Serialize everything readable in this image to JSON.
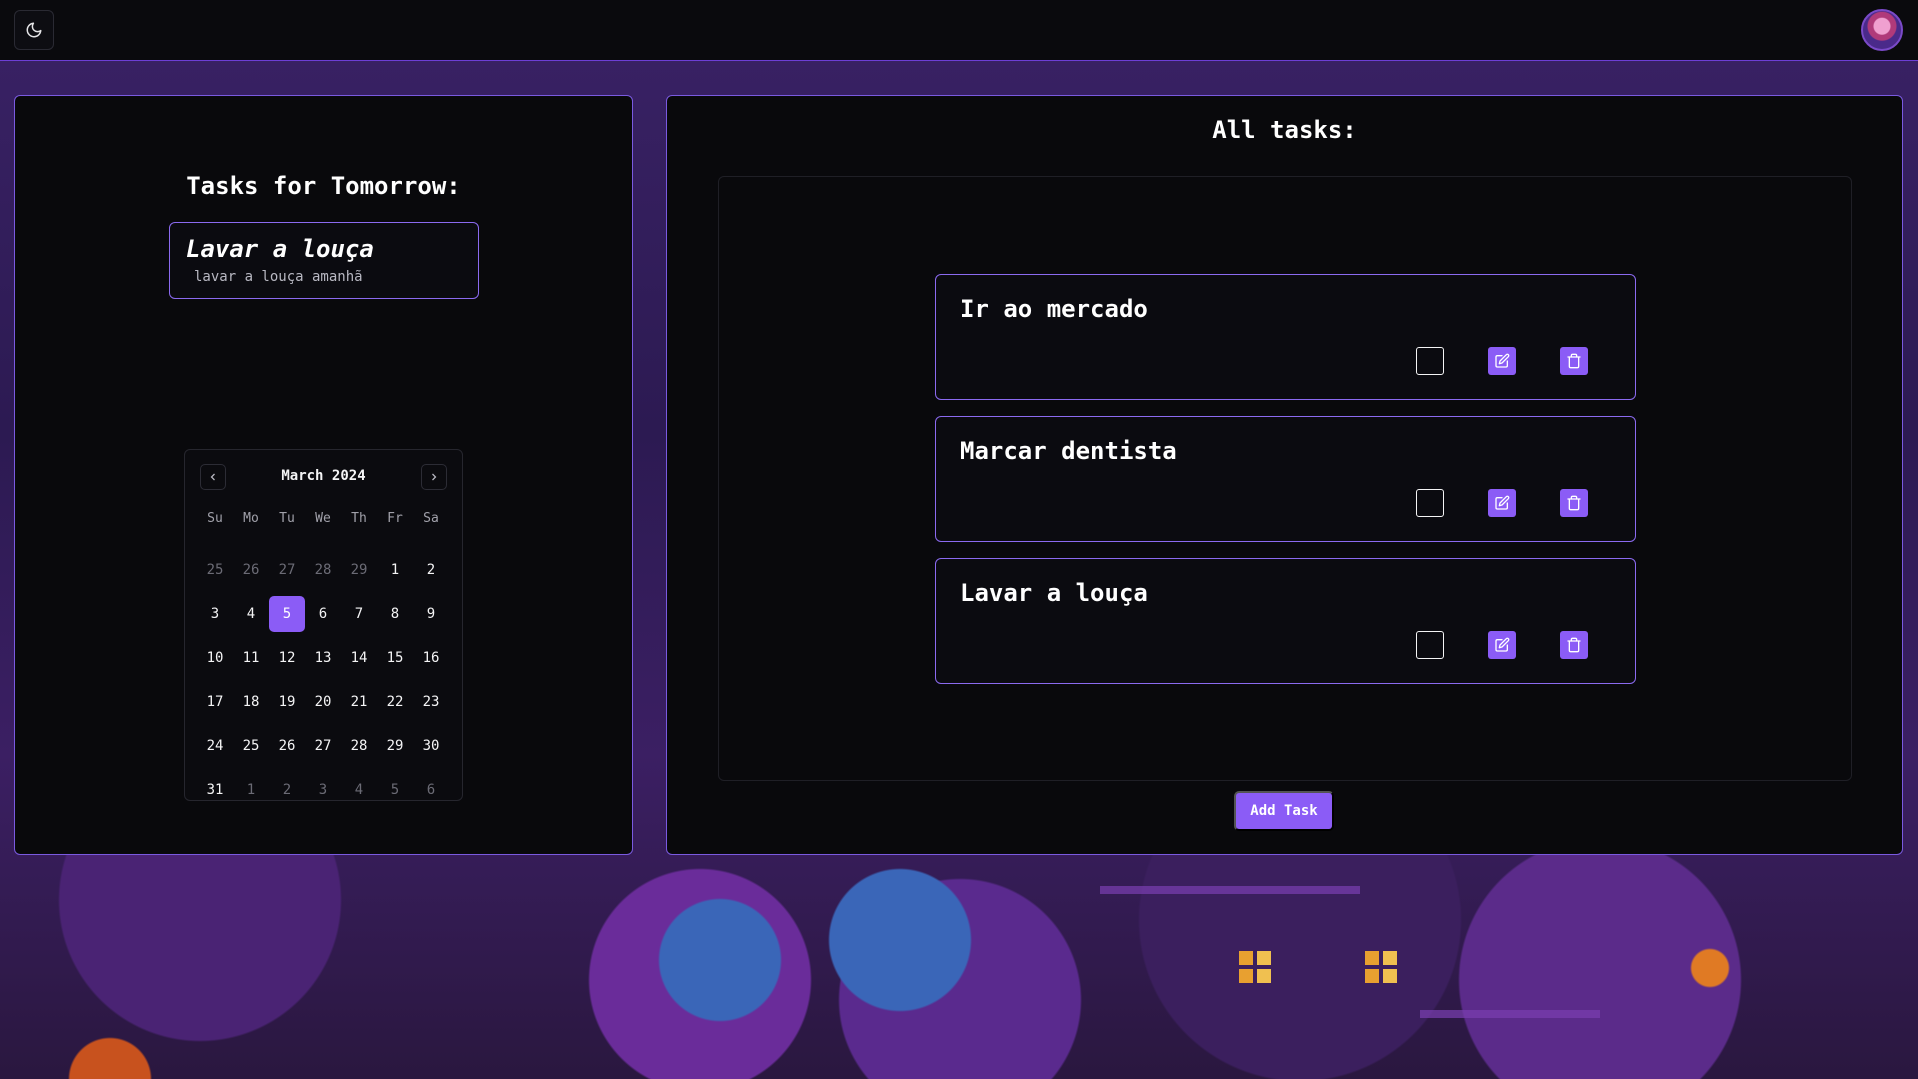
{
  "header": {
    "theme_toggle_icon": "moon-icon",
    "avatar_icon": "user-avatar"
  },
  "tomorrow": {
    "title": "Tasks for Tomorrow:",
    "tasks": [
      {
        "title": "Lavar a louça",
        "description": "lavar a louça amanhã"
      }
    ]
  },
  "calendar": {
    "month_label": "March 2024",
    "prev_icon": "chevron-left-icon",
    "next_icon": "chevron-right-icon",
    "weekdays": [
      "Su",
      "Mo",
      "Tu",
      "We",
      "Th",
      "Fr",
      "Sa"
    ],
    "weeks": [
      [
        "25",
        "26",
        "27",
        "28",
        "29",
        "1",
        "2"
      ],
      [
        "3",
        "4",
        "5",
        "6",
        "7",
        "8",
        "9"
      ],
      [
        "10",
        "11",
        "12",
        "13",
        "14",
        "15",
        "16"
      ],
      [
        "17",
        "18",
        "19",
        "20",
        "21",
        "22",
        "23"
      ],
      [
        "24",
        "25",
        "26",
        "27",
        "28",
        "29",
        "30"
      ],
      [
        "31",
        "1",
        "2",
        "3",
        "4",
        "5",
        "6"
      ]
    ],
    "selected_day": "5"
  },
  "all_tasks": {
    "title": "All tasks:",
    "tasks": [
      {
        "title": "Ir ao mercado"
      },
      {
        "title": "Marcar dentista"
      },
      {
        "title": "Lavar a louça"
      }
    ],
    "add_label": "Add Task"
  },
  "colors": {
    "accent": "#8b5cf6",
    "border_accent": "#8b6af0",
    "panel_bg": "#09090c"
  }
}
